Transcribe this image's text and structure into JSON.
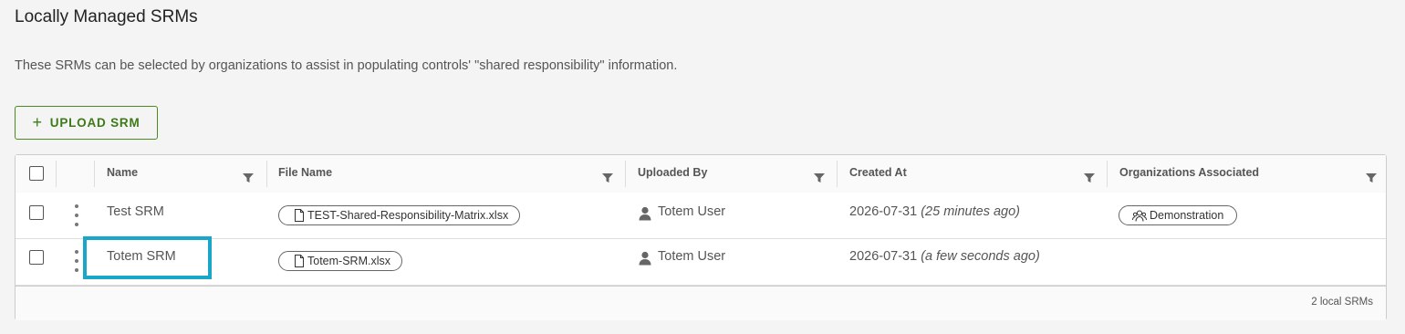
{
  "page": {
    "title": "Locally Managed SRMs",
    "description": "These SRMs can be selected by organizations to assist in populating controls' \"shared responsibility\" information.",
    "upload_label": "UPLOAD SRM"
  },
  "table": {
    "columns": [
      "Name",
      "File Name",
      "Uploaded By",
      "Created At",
      "Organizations Associated"
    ],
    "rows": [
      {
        "name": "Test SRM",
        "file_name": "TEST-Shared-Responsibility-Matrix.xlsx",
        "uploaded_by": "Totem User",
        "created_date": "2026-07-31",
        "created_relative": "(25 minutes ago)",
        "organization": "Demonstration"
      },
      {
        "name": "Totem SRM",
        "file_name": "Totem-SRM.xlsx",
        "uploaded_by": "Totem User",
        "created_date": "2026-07-31",
        "created_relative": "(a few seconds ago)",
        "organization": ""
      }
    ],
    "footer": "2 local SRMs"
  },
  "colors": {
    "accent": "#3d7a17",
    "highlight": "#1aa6c8"
  },
  "icons": {
    "upload": "plus-icon",
    "filter": "filter-icon",
    "row_actions": "kebab-icon",
    "file": "file-icon",
    "user": "user-icon",
    "organization": "group-icon"
  }
}
